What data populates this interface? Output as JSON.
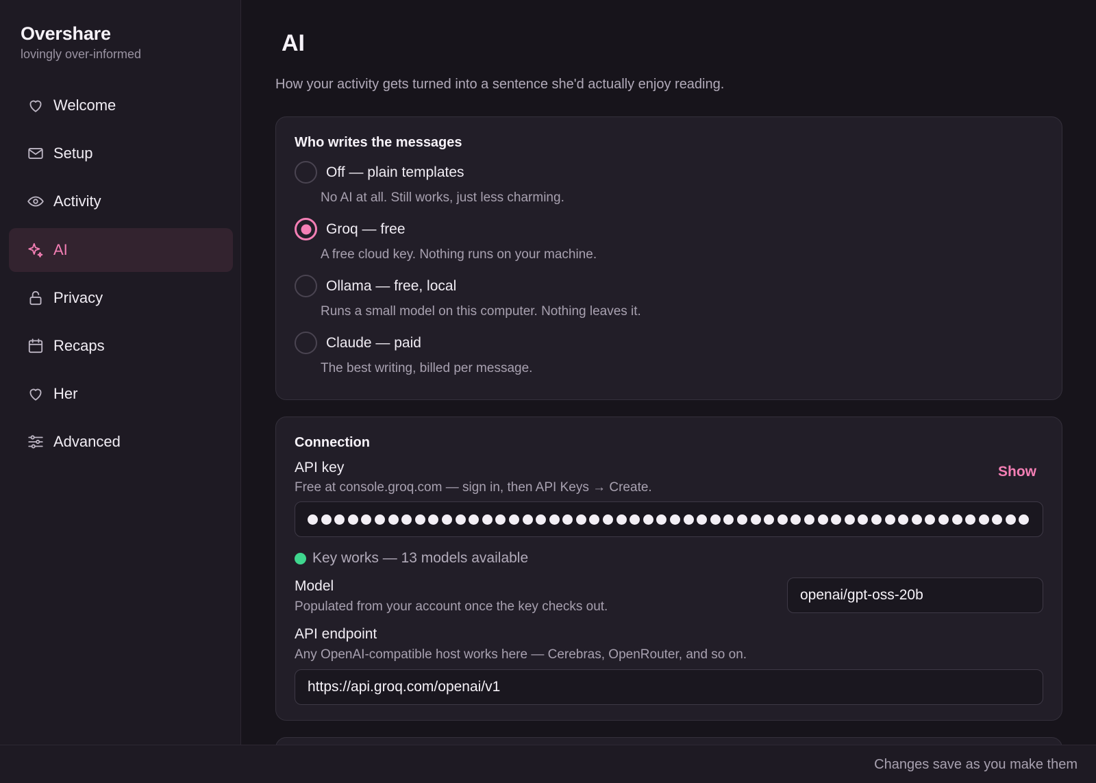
{
  "brand": {
    "name": "Overshare",
    "tagline": "lovingly over-informed"
  },
  "sidebar": {
    "items": [
      {
        "label": "Welcome",
        "icon": "heart-icon"
      },
      {
        "label": "Setup",
        "icon": "mail-icon"
      },
      {
        "label": "Activity",
        "icon": "eye-icon"
      },
      {
        "label": "AI",
        "icon": "sparkle-icon",
        "active": true
      },
      {
        "label": "Privacy",
        "icon": "lock-icon"
      },
      {
        "label": "Recaps",
        "icon": "calendar-icon"
      },
      {
        "label": "Her",
        "icon": "heart-icon"
      },
      {
        "label": "Advanced",
        "icon": "sliders-icon"
      }
    ]
  },
  "page": {
    "title": "AI",
    "subtitle": "How your activity gets turned into a sentence she'd actually enjoy reading."
  },
  "writers": {
    "title": "Who writes the messages",
    "options": [
      {
        "label": "Off — plain templates",
        "desc": "No AI at all. Still works, just less charming.",
        "selected": false
      },
      {
        "label": "Groq — free",
        "desc": "A free cloud key. Nothing runs on your machine.",
        "selected": true
      },
      {
        "label": "Ollama — free, local",
        "desc": "Runs a small model on this computer. Nothing leaves it.",
        "selected": false
      },
      {
        "label": "Claude — paid",
        "desc": "The best writing, billed per message.",
        "selected": false
      }
    ]
  },
  "connection": {
    "title": "Connection",
    "api_key_label": "API key",
    "api_key_help": "Free at console.groq.com — sign in, then API Keys → Create.",
    "show_label": "Show",
    "status_text": "Key works — 13 models available",
    "model_label": "Model",
    "model_help": "Populated from your account once the key checks out.",
    "model_value": "openai/gpt-oss-20b",
    "endpoint_label": "API endpoint",
    "endpoint_help": "Any OpenAI-compatible host works here — Cerebras, OpenRouter, and so on.",
    "endpoint_value": "https://api.groq.com/openai/v1"
  },
  "colors": {
    "accent": "#f47fb5",
    "success": "#3fd68e",
    "background": "#17141b"
  },
  "footer": {
    "text": "Changes save as you make them"
  }
}
